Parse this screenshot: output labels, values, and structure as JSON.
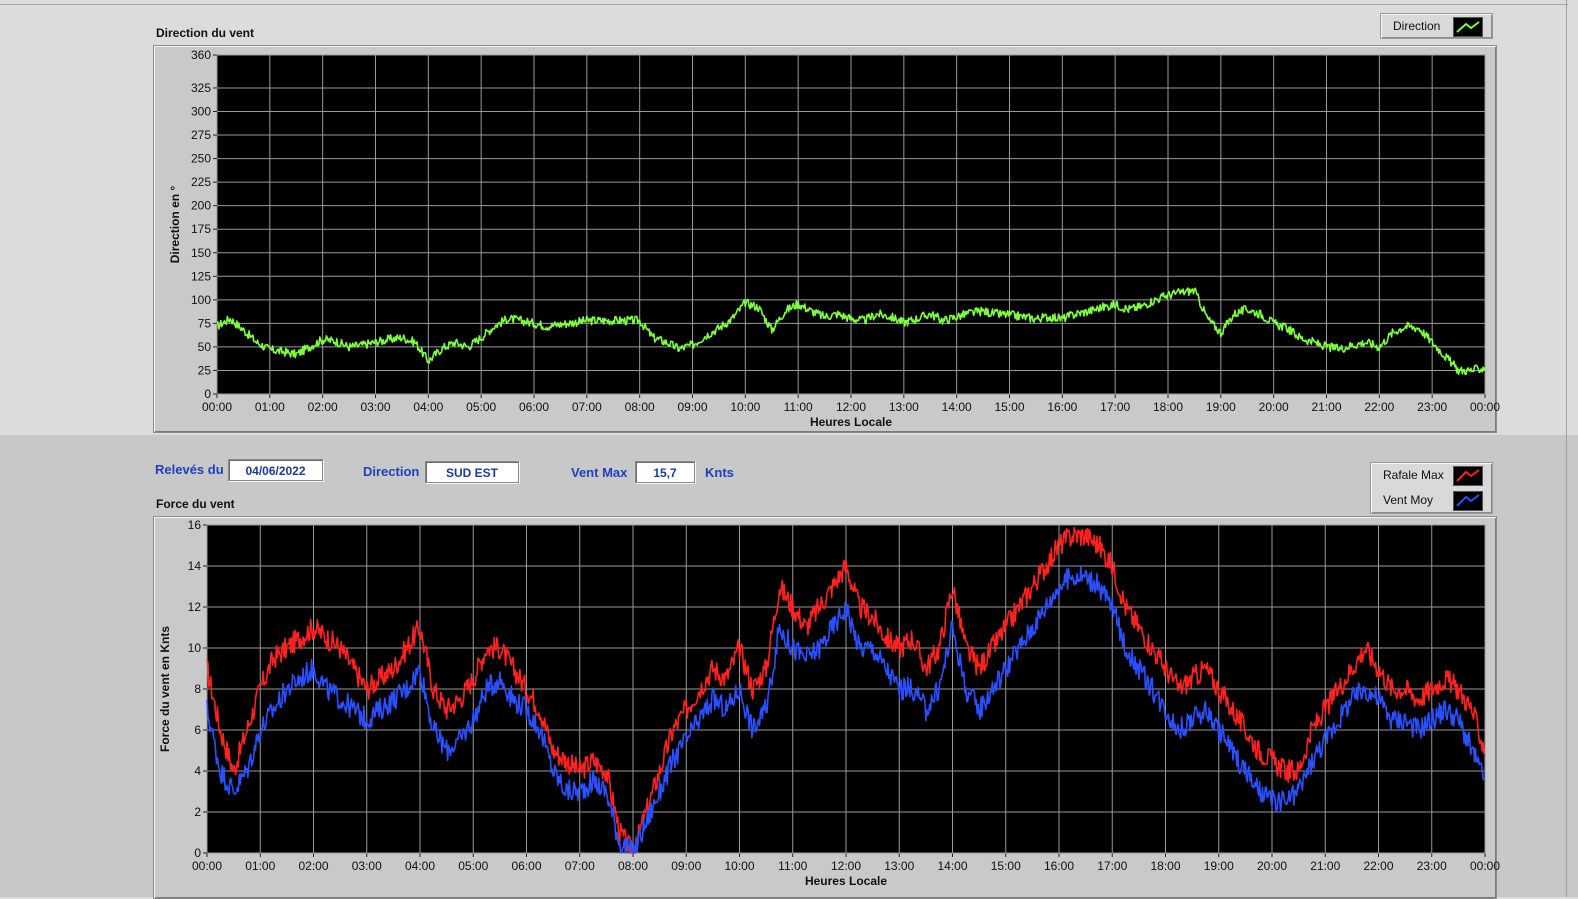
{
  "direction_panel": {
    "title": "Direction du vent",
    "legend": [
      {
        "label": "Direction",
        "color": "#7cff3a"
      }
    ]
  },
  "info_bar": {
    "date_label": "Relevés du",
    "date_value": "04/06/2022",
    "direction_label": "Direction",
    "direction_value": "SUD EST",
    "vent_max_label": "Vent Max",
    "vent_max_value": "15,7",
    "unit": "Knts"
  },
  "force_panel": {
    "title": "Force du vent",
    "legend": [
      {
        "label": "Rafale Max",
        "color": "#ff2020"
      },
      {
        "label": "Vent Moy",
        "color": "#2a4fff"
      }
    ]
  },
  "chart_data": [
    {
      "type": "line",
      "title": "Direction du vent",
      "xlabel": "Heures Locale",
      "ylabel": "Direction en °",
      "xticks": [
        "00:00",
        "01:00",
        "02:00",
        "03:00",
        "04:00",
        "05:00",
        "06:00",
        "07:00",
        "08:00",
        "09:00",
        "10:00",
        "11:00",
        "12:00",
        "13:00",
        "14:00",
        "15:00",
        "16:00",
        "17:00",
        "18:00",
        "19:00",
        "20:00",
        "21:00",
        "22:00",
        "23:00",
        "00:00"
      ],
      "yticks": [
        0,
        25,
        50,
        75,
        100,
        125,
        150,
        175,
        200,
        225,
        250,
        275,
        300,
        325,
        360
      ],
      "ylim": [
        0,
        360
      ],
      "xlim_hours": [
        0,
        24
      ],
      "grid": true,
      "legend_position": "top-right",
      "series": [
        {
          "name": "Direction",
          "color": "#7cff3a",
          "x_hours": [
            0,
            0.25,
            0.5,
            0.75,
            1,
            1.25,
            1.5,
            1.75,
            2,
            2.25,
            2.5,
            2.75,
            3,
            3.25,
            3.5,
            3.75,
            4,
            4.25,
            4.5,
            4.75,
            5,
            5.25,
            5.5,
            5.75,
            6,
            6.25,
            6.5,
            6.75,
            7,
            7.25,
            7.5,
            7.75,
            8,
            8.25,
            8.5,
            8.75,
            9,
            9.25,
            9.5,
            9.75,
            10,
            10.25,
            10.5,
            10.75,
            11,
            11.25,
            11.5,
            11.75,
            12,
            12.25,
            12.5,
            12.75,
            13,
            13.25,
            13.5,
            13.75,
            14,
            14.25,
            14.5,
            14.75,
            15,
            15.25,
            15.5,
            15.75,
            16,
            16.25,
            16.5,
            16.75,
            17,
            17.25,
            17.5,
            17.75,
            18,
            18.25,
            18.5,
            18.75,
            19,
            19.25,
            19.5,
            19.75,
            20,
            20.25,
            20.5,
            20.75,
            21,
            21.25,
            21.5,
            21.75,
            22,
            22.25,
            22.5,
            22.75,
            23,
            23.25,
            23.5,
            23.75,
            24
          ],
          "values": [
            72,
            80,
            68,
            55,
            47,
            45,
            42,
            50,
            58,
            56,
            50,
            52,
            55,
            58,
            60,
            55,
            35,
            48,
            55,
            50,
            60,
            72,
            80,
            78,
            75,
            72,
            74,
            76,
            78,
            78,
            78,
            78,
            78,
            60,
            55,
            48,
            52,
            62,
            70,
            80,
            97,
            92,
            68,
            88,
            96,
            88,
            82,
            85,
            80,
            78,
            85,
            82,
            76,
            80,
            85,
            78,
            82,
            86,
            88,
            85,
            84,
            82,
            80,
            82,
            80,
            85,
            88,
            92,
            95,
            90,
            93,
            100,
            105,
            108,
            110,
            80,
            65,
            85,
            90,
            85,
            75,
            70,
            60,
            55,
            50,
            48,
            52,
            55,
            50,
            65,
            72,
            70,
            55,
            40,
            25,
            25,
            28
          ]
        }
      ]
    },
    {
      "type": "line",
      "title": "Force du vent",
      "xlabel": "Heures Locale",
      "ylabel": "Force du vent en Knts",
      "xticks": [
        "00:00",
        "01:00",
        "02:00",
        "03:00",
        "04:00",
        "05:00",
        "06:00",
        "07:00",
        "08:00",
        "09:00",
        "10:00",
        "11:00",
        "12:00",
        "13:00",
        "14:00",
        "15:00",
        "16:00",
        "17:00",
        "18:00",
        "19:00",
        "20:00",
        "21:00",
        "22:00",
        "23:00",
        "00:00"
      ],
      "yticks": [
        0,
        2,
        4,
        6,
        8,
        10,
        12,
        14,
        16
      ],
      "ylim": [
        0,
        16
      ],
      "xlim_hours": [
        0,
        24
      ],
      "grid": true,
      "legend_position": "top-right",
      "series": [
        {
          "name": "Rafale Max",
          "color": "#ff2020",
          "x_hours": [
            0,
            0.25,
            0.5,
            0.75,
            1,
            1.25,
            1.5,
            1.75,
            2,
            2.25,
            2.5,
            2.75,
            3,
            3.25,
            3.5,
            3.75,
            4,
            4.25,
            4.5,
            4.75,
            5,
            5.25,
            5.5,
            5.75,
            6,
            6.25,
            6.5,
            6.75,
            7,
            7.25,
            7.5,
            7.75,
            8,
            8.25,
            8.5,
            8.75,
            9,
            9.25,
            9.5,
            9.75,
            10,
            10.25,
            10.5,
            10.75,
            11,
            11.25,
            11.5,
            11.75,
            12,
            12.25,
            12.5,
            12.75,
            13,
            13.25,
            13.5,
            13.75,
            14,
            14.25,
            14.5,
            14.75,
            15,
            15.25,
            15.5,
            15.75,
            16,
            16.25,
            16.5,
            16.75,
            17,
            17.25,
            17.5,
            17.75,
            18,
            18.25,
            18.5,
            18.75,
            19,
            19.25,
            19.5,
            19.75,
            20,
            20.25,
            20.5,
            20.75,
            21,
            21.25,
            21.5,
            21.75,
            22,
            22.25,
            22.5,
            22.75,
            23,
            23.25,
            23.5,
            23.75,
            24
          ],
          "values": [
            9,
            6,
            4,
            6,
            8,
            9.5,
            10,
            10.5,
            11,
            10.5,
            10,
            9,
            8,
            8.5,
            9,
            10,
            11,
            8,
            7,
            7.5,
            8.5,
            10,
            10,
            9,
            8,
            7,
            5,
            4.5,
            4,
            4.5,
            4,
            1,
            0,
            2,
            4,
            6,
            7,
            8,
            9,
            8.5,
            10,
            8,
            9,
            13,
            12,
            11,
            12,
            13,
            14,
            12,
            11.5,
            10.5,
            10,
            10.5,
            9,
            10,
            13,
            10,
            9,
            10,
            11,
            12,
            13,
            14,
            15,
            15.5,
            15.5,
            15,
            14,
            12,
            11,
            10,
            9,
            8,
            8.5,
            9,
            8,
            7,
            6,
            5,
            4.5,
            4,
            4,
            6,
            7,
            8,
            9,
            10,
            9,
            8,
            8,
            7.5,
            8,
            8.5,
            8,
            7,
            5,
            4,
            3
          ]
        },
        {
          "name": "Vent Moy",
          "color": "#2a4fff",
          "x_hours": [
            0,
            0.25,
            0.5,
            0.75,
            1,
            1.25,
            1.5,
            1.75,
            2,
            2.25,
            2.5,
            2.75,
            3,
            3.25,
            3.5,
            3.75,
            4,
            4.25,
            4.5,
            4.75,
            5,
            5.25,
            5.5,
            5.75,
            6,
            6.25,
            6.5,
            6.75,
            7,
            7.25,
            7.5,
            7.75,
            8,
            8.25,
            8.5,
            8.75,
            9,
            9.25,
            9.5,
            9.75,
            10,
            10.25,
            10.5,
            10.75,
            11,
            11.25,
            11.5,
            11.75,
            12,
            12.25,
            12.5,
            12.75,
            13,
            13.25,
            13.5,
            13.75,
            14,
            14.25,
            14.5,
            14.75,
            15,
            15.25,
            15.5,
            15.75,
            16,
            16.25,
            16.5,
            16.75,
            17,
            17.25,
            17.5,
            17.75,
            18,
            18.25,
            18.5,
            18.75,
            19,
            19.25,
            19.5,
            19.75,
            20,
            20.25,
            20.5,
            20.75,
            21,
            21.25,
            21.5,
            21.75,
            22,
            22.25,
            22.5,
            22.75,
            23,
            23.25,
            23.5,
            23.75,
            24
          ],
          "values": [
            7,
            4,
            3,
            4,
            6,
            7,
            8,
            8.5,
            9,
            8,
            7.5,
            7,
            6.5,
            7,
            7.5,
            8,
            9,
            6,
            5,
            5.5,
            6.5,
            8,
            8.5,
            7.5,
            7,
            6,
            4,
            3,
            3,
            3.5,
            3,
            0.5,
            0,
            1.5,
            3,
            4.5,
            5.5,
            6.5,
            7.5,
            7,
            8,
            6,
            7,
            11,
            10,
            9.5,
            10,
            11,
            12,
            10,
            10,
            9,
            8,
            8,
            7,
            8,
            11,
            8,
            7,
            8,
            9,
            10,
            11,
            12,
            13,
            13.5,
            13.5,
            13,
            12,
            10,
            9,
            8,
            7,
            6,
            6.5,
            7,
            6,
            5,
            4,
            3,
            2.5,
            2.5,
            3,
            4.5,
            5.5,
            6.5,
            7.5,
            8,
            7.5,
            6.5,
            6.5,
            6,
            6.5,
            7,
            6.5,
            5,
            3.5,
            2.5,
            1.5
          ]
        }
      ]
    }
  ]
}
